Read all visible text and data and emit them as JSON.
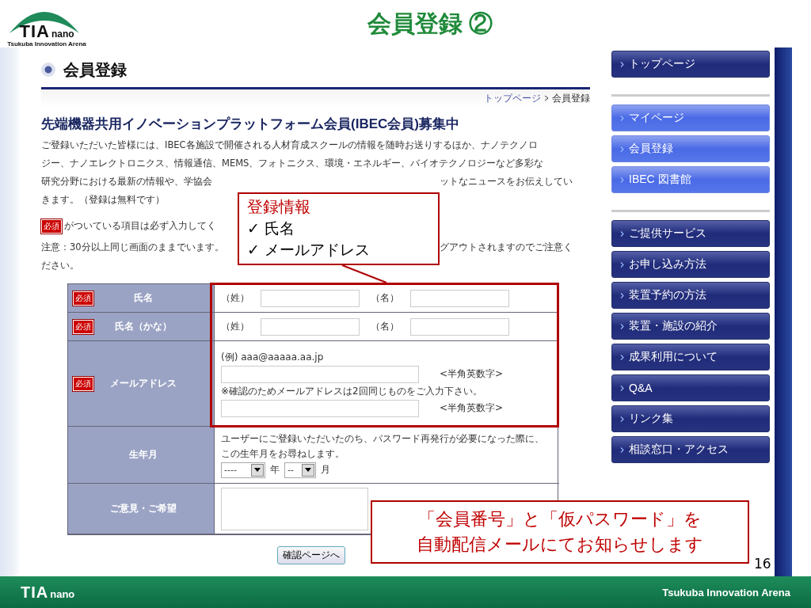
{
  "slide": {
    "title": "会員登録 ②",
    "page_number": "16"
  },
  "logo": {
    "mark": "TIA",
    "sub": "nano",
    "tagline": "Tsukuba Innovation Arena"
  },
  "web_page": {
    "heading": "会員登録",
    "breadcrumb": [
      {
        "label": "トップページ",
        "kind": "link"
      },
      {
        "label": "会員登録",
        "kind": "current"
      }
    ],
    "section_title": "先端機器共用イノベーションプラットフォーム会員(IBEC会員)募集中",
    "intro_lines": [
      {
        "segments": [
          "ご登録いただいた皆様には、IBEC各施設で開催される人材育成スクールの情報を随時お送りするほか、ナノテクノロ"
        ]
      },
      {
        "segments": [
          "ジー、ナノエレクトロニクス、情報通信、MEMS、フォトニクス、環境・エネルギー、バイオテクノロジーなど多彩な"
        ]
      },
      {
        "segments": [
          "研究分野における最新の情報や、学協会",
          "ットなニュースをお伝えしてい"
        ]
      },
      {
        "segments": [
          "きます。（登録は無料です）"
        ]
      }
    ],
    "required_note": {
      "badge": "必須",
      "segments": [
        "がついている項目は必ず入力してく"
      ]
    },
    "caution_lines": [
      {
        "segments": [
          "注意：30分以上同じ画面のままでいます。",
          "グアウトされますのでご注意く"
        ]
      },
      {
        "segments": [
          "ださい。"
        ]
      }
    ],
    "form_rows": [
      {
        "kind": "name",
        "badge": "必須",
        "label": "氏名",
        "parts": [
          "（姓）",
          "（名）"
        ]
      },
      {
        "kind": "name",
        "badge": "必須",
        "label": "氏名（かな）",
        "parts": [
          "（姓）",
          "（名）"
        ]
      },
      {
        "kind": "email",
        "badge": "必須",
        "label": "メールアドレス",
        "example": "(例) aaa@aaaaa.aa.jp",
        "hint": "<半角英数字>",
        "note": "※確認のためメールアドレスは2回同じものをご入力下さい。",
        "hint2": "<半角英数字>"
      },
      {
        "kind": "birth",
        "label": "生年月",
        "note_lines": [
          "ユーザーにご登録いただいたのち、パスワード再発行が必要になった際に、",
          "この生年月をお尋ねします。"
        ],
        "year": {
          "value": "----",
          "unit": "年"
        },
        "month": {
          "value": "--",
          "unit": "月"
        }
      },
      {
        "kind": "comment",
        "label": "ご意見・ご希望"
      }
    ],
    "submit_button": "確認ページへ"
  },
  "nav_groups": [
    [
      {
        "label": "トップページ",
        "kind": "dark"
      }
    ],
    [
      {
        "label": "マイページ",
        "kind": "light"
      },
      {
        "label": "会員登録",
        "kind": "light"
      },
      {
        "label": "IBEC 図書館",
        "kind": "light"
      }
    ],
    [
      {
        "label": "ご提供サービス",
        "kind": "dark"
      },
      {
        "label": "お申し込み方法",
        "kind": "dark"
      },
      {
        "label": "装置予約の方法",
        "kind": "dark"
      },
      {
        "label": "装置・施設の紹介",
        "kind": "dark"
      },
      {
        "label": "成果利用について",
        "kind": "dark"
      },
      {
        "label": "Q&A",
        "kind": "dark"
      },
      {
        "label": "リンク集",
        "kind": "dark"
      },
      {
        "label": "相談窓口・アクセス",
        "kind": "dark"
      }
    ]
  ],
  "callouts": [
    {
      "kind": "list",
      "title": "登録情報",
      "items": [
        "✓ 氏名",
        "✓ メールアドレス"
      ]
    },
    {
      "kind": "notice",
      "lines": [
        "「会員番号」と「仮パスワード」を",
        "自動配信メールにてお知らせします"
      ]
    }
  ],
  "footer": {
    "mark": "TIA",
    "sub": "nano",
    "tagline": "Tsukuba Innovation Arena"
  }
}
